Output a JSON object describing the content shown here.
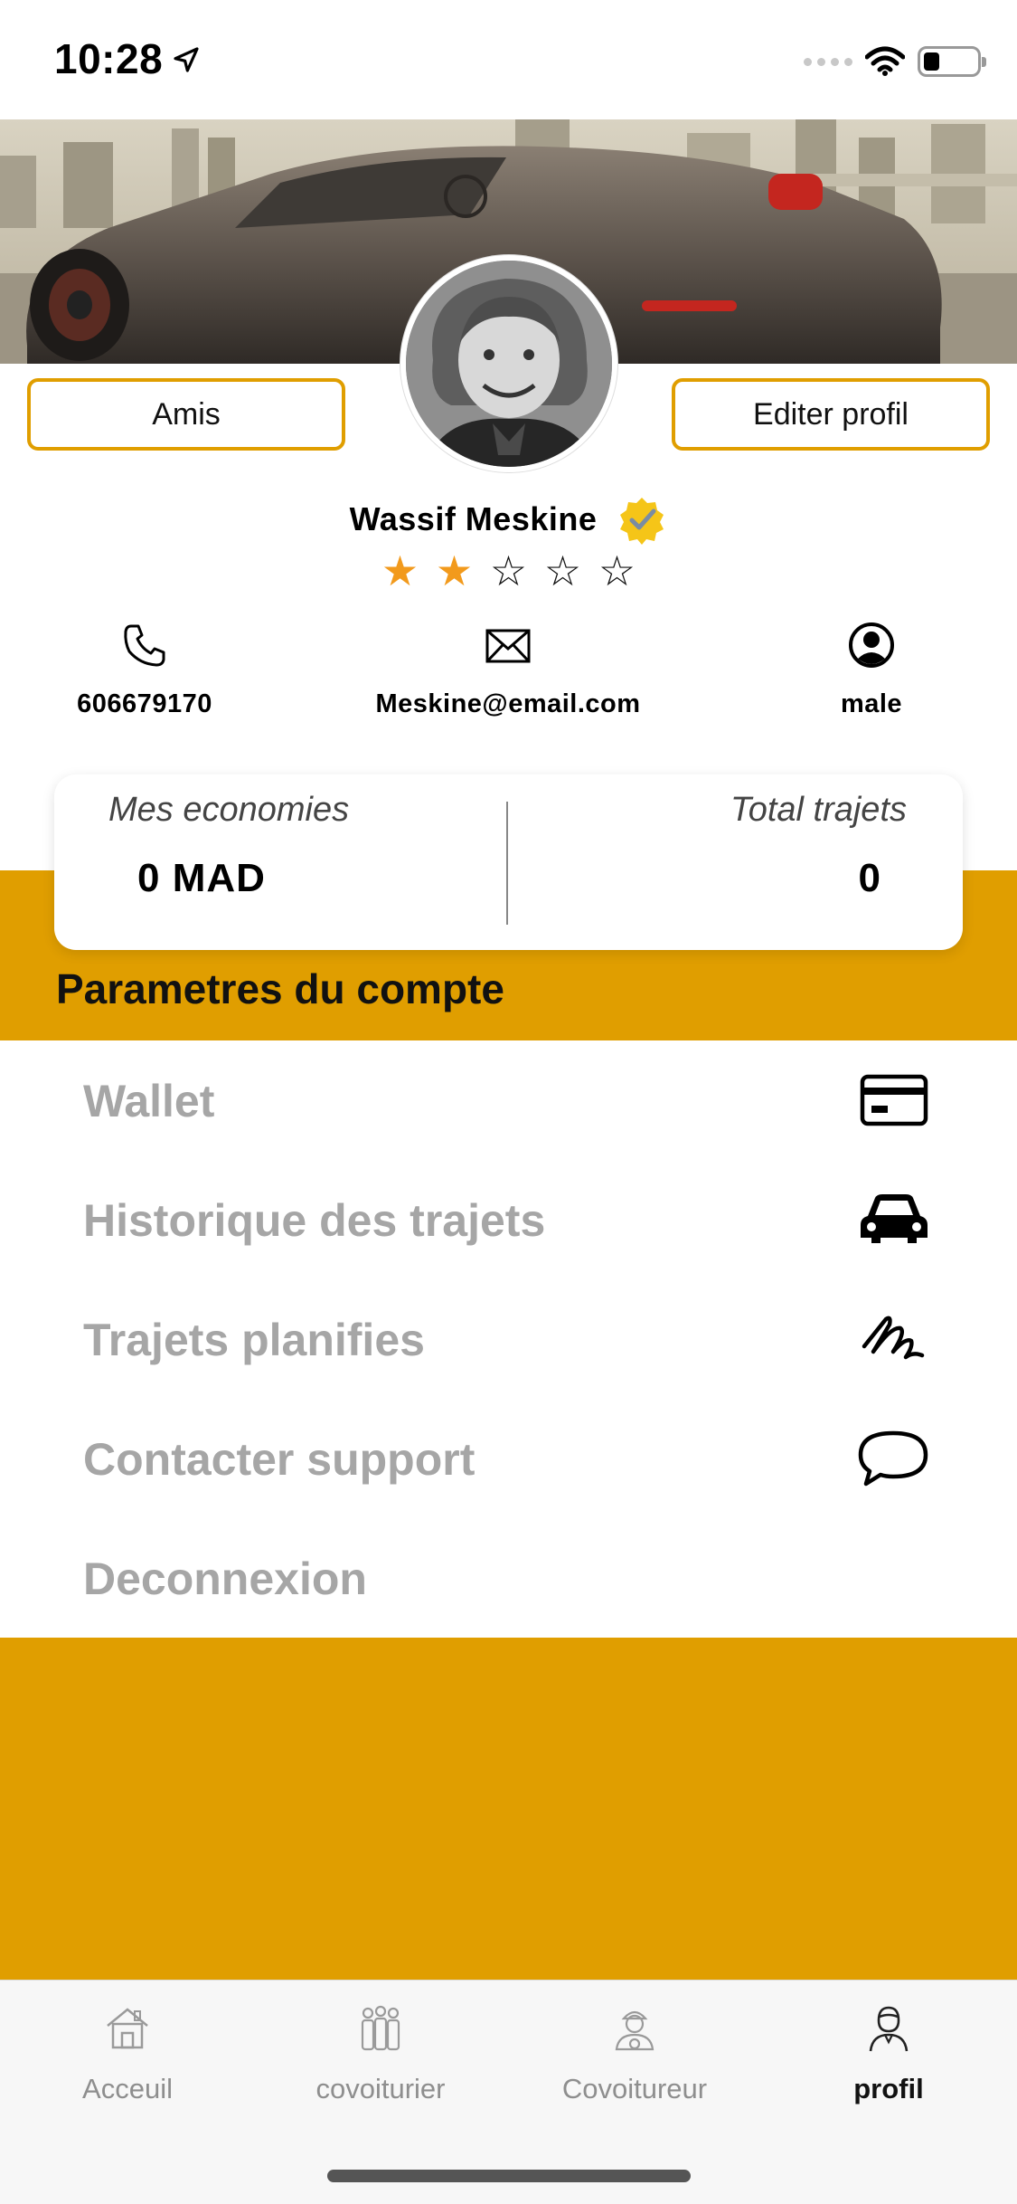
{
  "status_bar": {
    "time": "10:28",
    "battery_level": 0.3,
    "icons": [
      "location-arrow-icon",
      "cellular-signal-icon",
      "wifi-icon",
      "battery-icon"
    ]
  },
  "profile": {
    "cover_image": "sports-car-city-photo",
    "avatar_image": "user-portrait-photo",
    "friends_button": "Amis",
    "edit_button": "Editer profil",
    "name": "Wassif Meskine",
    "verified_icon": "verified-badge-icon",
    "rating": 2,
    "rating_max": 5,
    "phone": "606679170",
    "email": "Meskine@email.com",
    "gender": "male",
    "contact_icons": [
      "phone-icon",
      "envelope-icon",
      "user-circle-icon"
    ]
  },
  "stats": {
    "savings_label": "Mes economies",
    "savings_value": "0 MAD",
    "trips_label": "Total trajets",
    "trips_value": "0"
  },
  "settings": {
    "title": "Parametres du compte",
    "items": [
      {
        "label": "Wallet",
        "icon": "credit-card-icon"
      },
      {
        "label": "Historique des trajets",
        "icon": "car-icon"
      },
      {
        "label": "Trajets planifies",
        "icon": "scribble-route-icon"
      },
      {
        "label": "Contacter support",
        "icon": "chat-bubble-icon"
      },
      {
        "label": "Deconnexion",
        "icon": ""
      }
    ]
  },
  "tabbar": {
    "items": [
      {
        "label": "Acceuil",
        "icon": "house-icon",
        "active": false
      },
      {
        "label": "covoiturier",
        "icon": "group-people-icon",
        "active": false
      },
      {
        "label": "Covoitureur",
        "icon": "driver-icon",
        "active": false
      },
      {
        "label": "profil",
        "icon": "person-icon",
        "active": true
      }
    ]
  },
  "colors": {
    "accent": "#e09e00",
    "star_active": "#f29a1c",
    "muted_text": "#a6a6a6"
  }
}
